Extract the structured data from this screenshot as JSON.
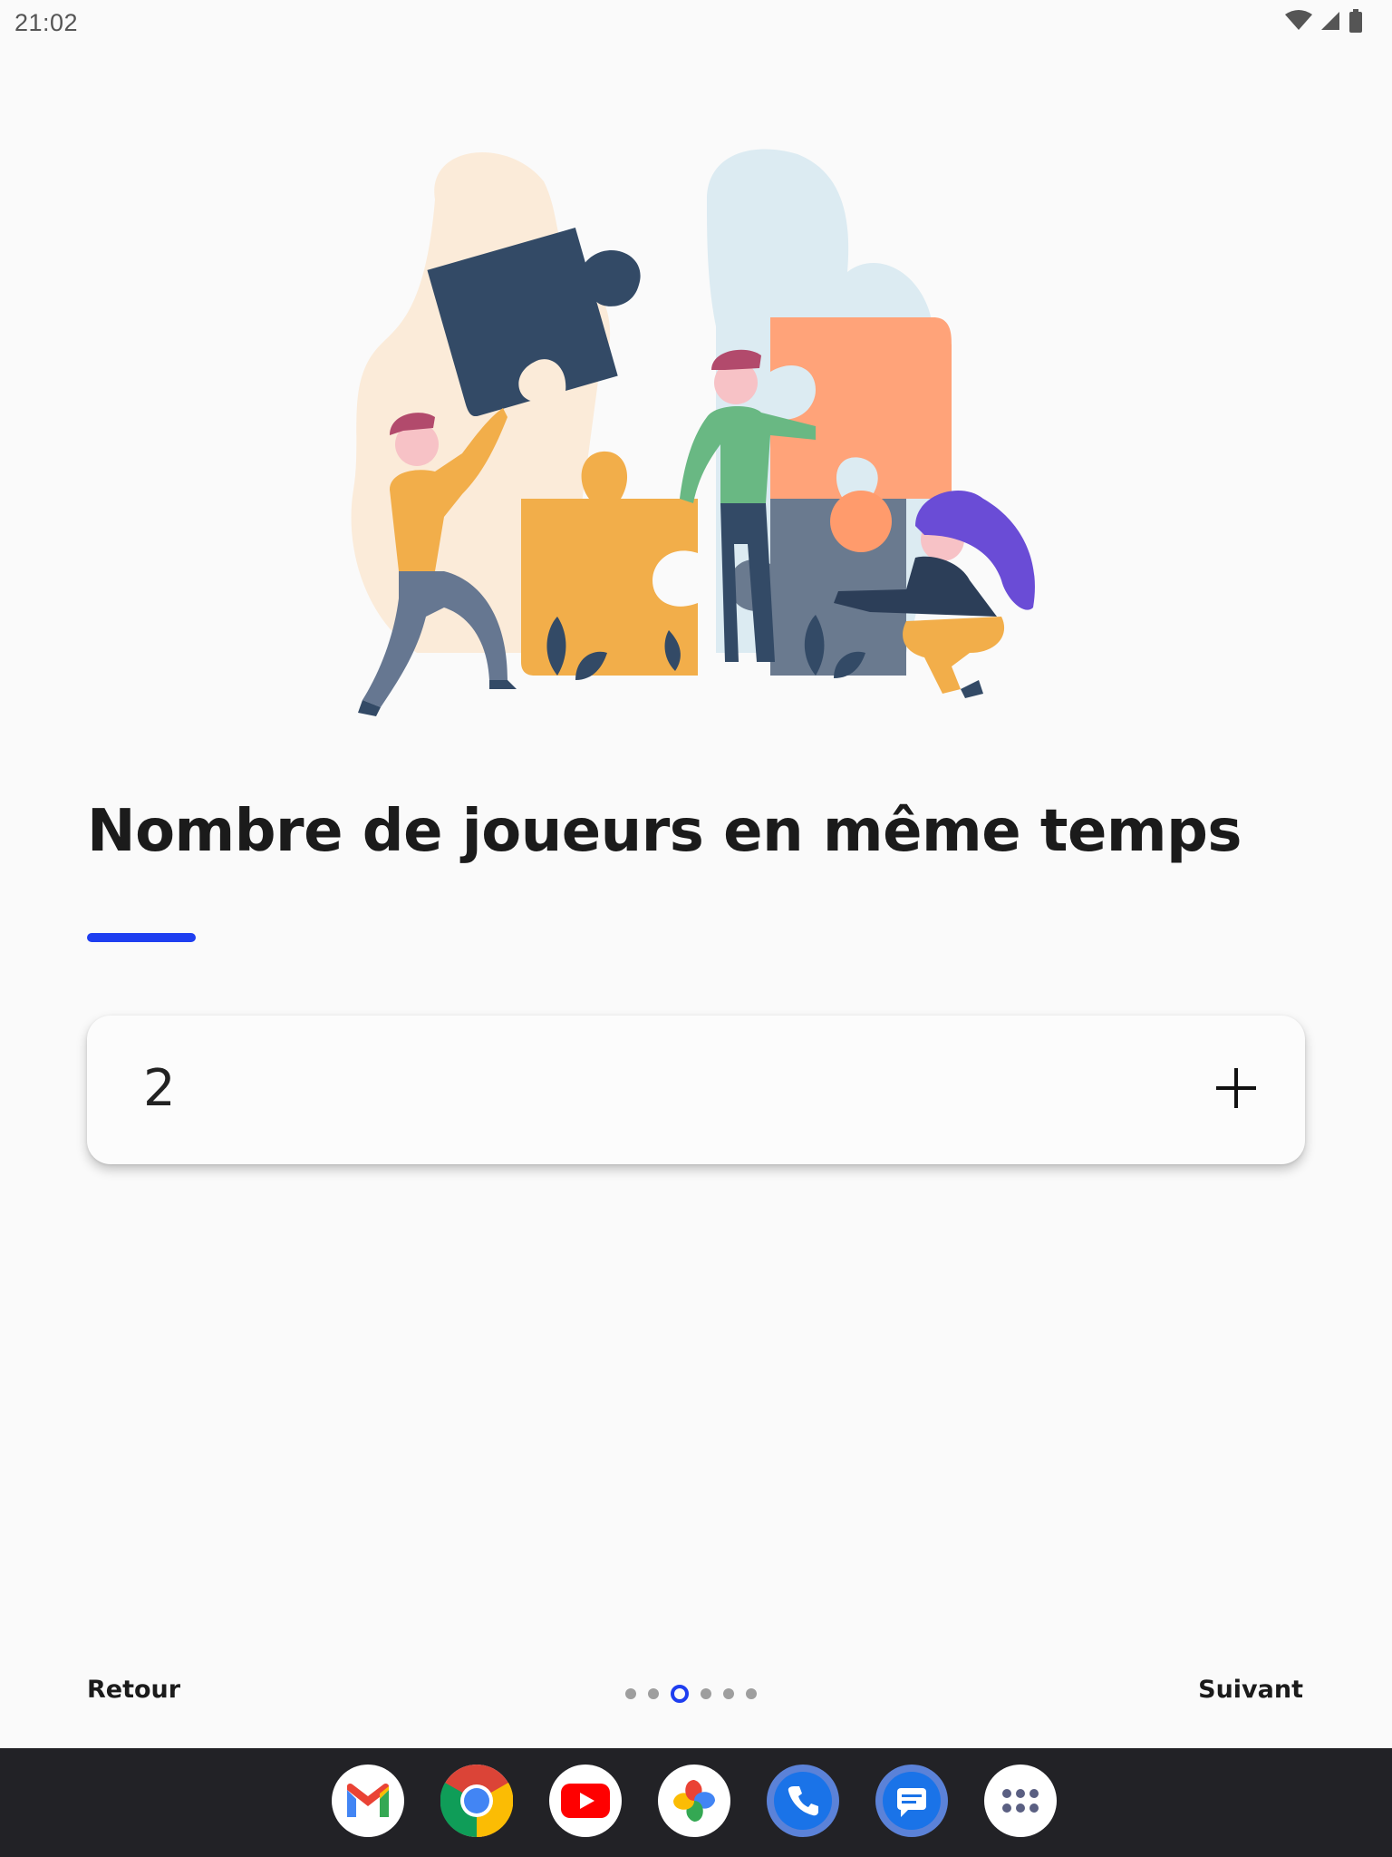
{
  "status_bar": {
    "time": "21:02",
    "icons": [
      "wifi-icon",
      "signal-icon",
      "battery-icon"
    ]
  },
  "illustration": {
    "description_icon": "puzzle-team-illustration"
  },
  "main": {
    "title": "Nombre de joueurs en même temps",
    "accent_color": "#1e3ef0",
    "stepper": {
      "value": "2",
      "increment_icon": "plus-icon"
    }
  },
  "footer": {
    "back_label": "Retour",
    "next_label": "Suivant",
    "pages_total": 6,
    "current_page": 3
  },
  "dock": {
    "apps": [
      "gmail-icon",
      "chrome-icon",
      "youtube-icon",
      "photos-icon",
      "phone-icon",
      "messages-icon",
      "app-drawer-icon"
    ]
  }
}
